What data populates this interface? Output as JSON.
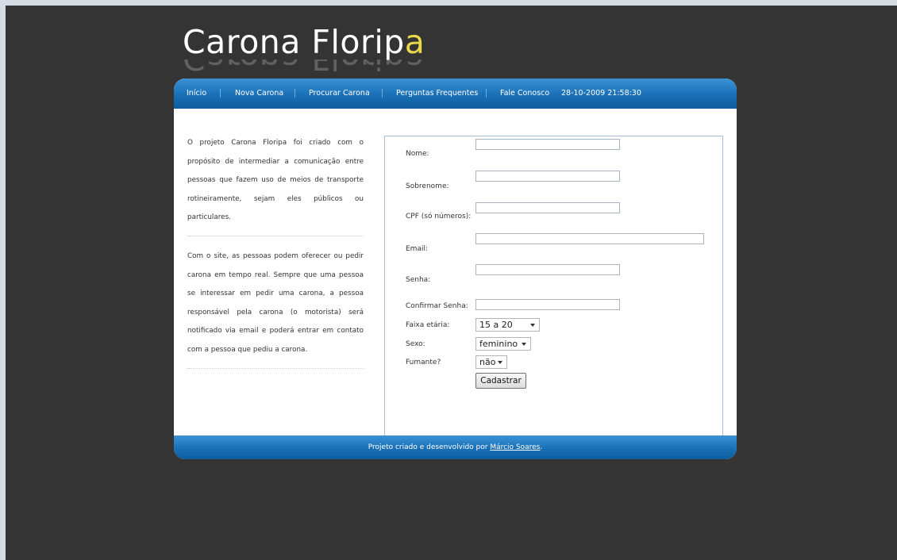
{
  "logo": {
    "main": "Carona Florip",
    "accent": "a"
  },
  "nav": {
    "items": [
      "Início",
      "Nova Carona",
      "Procurar Carona",
      "Perguntas Frequentes",
      "Fale Conosco"
    ],
    "datetime": "28-10-2009 21:58:30"
  },
  "intro": {
    "p1": "O projeto Carona Floripa foi criado com o propósito de intermediar a comunicação entre pessoas que fazem uso de meios de transporte rotineiramente, sejam eles públicos ou particulares.",
    "p2": "Com o site, as pessoas podem oferecer ou pedir carona em tempo real. Sempre que uma pessoa se interessar em pedir uma carona, a pessoa responsável pela carona (o motorista) será notificado via email e poderá entrar em contato com a pessoa que pediu a carona."
  },
  "form": {
    "labels": {
      "nome": "Nome:",
      "sobrenome": "Sobrenome:",
      "cpf": "CPF (só números):",
      "email": "Email:",
      "senha": "Senha:",
      "confirmar": "Confirmar Senha:",
      "faixa": "Faixa etária:",
      "sexo": "Sexo:",
      "fumante": "Fumante?"
    },
    "values": {
      "nome": "",
      "sobrenome": "",
      "cpf": "",
      "email": "",
      "senha": "",
      "confirmar": ""
    },
    "selects": {
      "faixa": "15 a 20",
      "sexo": "feminino",
      "fumante": "não"
    },
    "submit": "Cadastrar"
  },
  "footer": {
    "text": "Projeto criado e desenvolvido por ",
    "author": "Márcio Soares",
    "end": "."
  },
  "colors": {
    "background": "#343434",
    "bar": "#1a6fb5",
    "accent": "#e8d84a"
  }
}
